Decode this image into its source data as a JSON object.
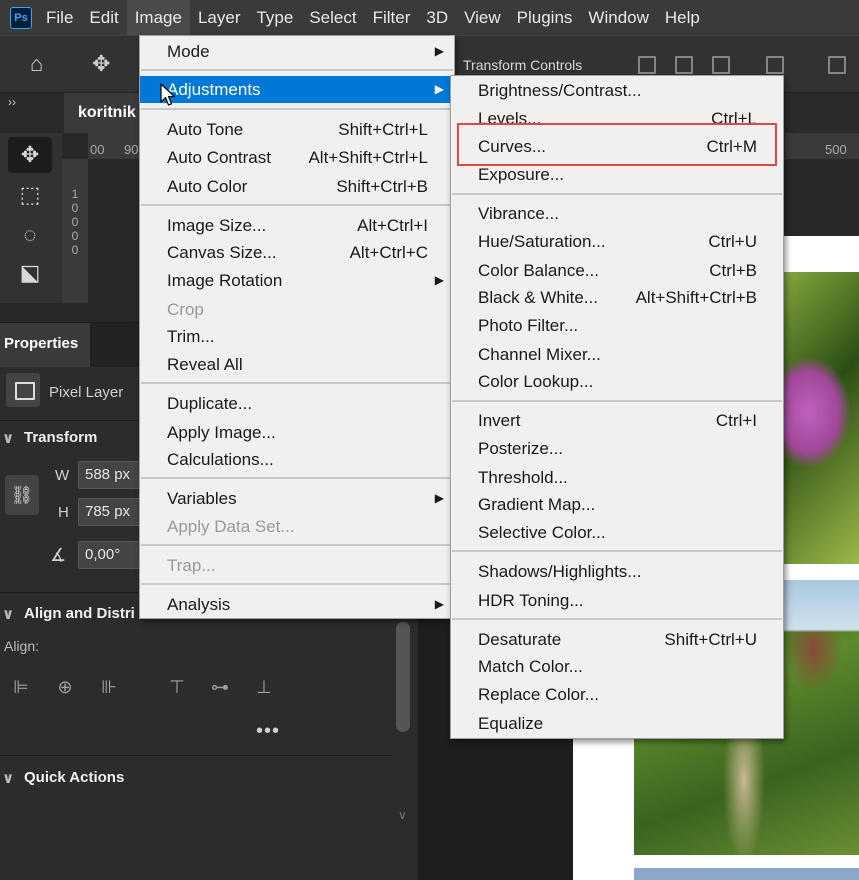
{
  "app": {
    "logo": "Ps"
  },
  "menubar": {
    "items": [
      "File",
      "Edit",
      "Image",
      "Layer",
      "Type",
      "Select",
      "Filter",
      "3D",
      "View",
      "Plugins",
      "Window",
      "Help"
    ],
    "active": "Image"
  },
  "options_bar": {
    "transform_controls": "Transform Controls"
  },
  "document": {
    "tab_title": "koritnik"
  },
  "rulers": {
    "top_left": [
      "00",
      "90"
    ],
    "top_right": "500",
    "left_digits": [
      "1",
      "0",
      "0",
      "0",
      "0"
    ]
  },
  "properties": {
    "tab": "Properties",
    "layer_type": "Pixel Layer",
    "transform": {
      "title": "Transform",
      "w_label": "W",
      "w_value": "588 px",
      "h_label": "H",
      "h_value": "785 px",
      "angle_value": "0,00°"
    },
    "align": {
      "title": "Align and Distri",
      "label": "Align:",
      "more": "•••"
    },
    "quick_actions": {
      "title": "Quick Actions"
    }
  },
  "image_menu": {
    "items": [
      {
        "label": "Mode",
        "submenu": true
      },
      {
        "label": "Adjustments",
        "submenu": true,
        "highlight": true
      },
      {
        "label": "Auto Tone",
        "shortcut": "Shift+Ctrl+L"
      },
      {
        "label": "Auto Contrast",
        "shortcut": "Alt+Shift+Ctrl+L"
      },
      {
        "label": "Auto Color",
        "shortcut": "Shift+Ctrl+B"
      },
      {
        "label": "Image Size...",
        "shortcut": "Alt+Ctrl+I"
      },
      {
        "label": "Canvas Size...",
        "shortcut": "Alt+Ctrl+C"
      },
      {
        "label": "Image Rotation",
        "submenu": true
      },
      {
        "label": "Crop",
        "disabled": true
      },
      {
        "label": "Trim..."
      },
      {
        "label": "Reveal All"
      },
      {
        "label": "Duplicate..."
      },
      {
        "label": "Apply Image..."
      },
      {
        "label": "Calculations..."
      },
      {
        "label": "Variables",
        "submenu": true
      },
      {
        "label": "Apply Data Set...",
        "disabled": true
      },
      {
        "label": "Trap...",
        "disabled": true
      },
      {
        "label": "Analysis",
        "submenu": true
      }
    ]
  },
  "adjustments_menu": {
    "items": [
      {
        "label": "Brightness/Contrast..."
      },
      {
        "label": "Levels...",
        "shortcut": "Ctrl+L"
      },
      {
        "label": "Curves...",
        "shortcut": "Ctrl+M",
        "outlined": true
      },
      {
        "label": "Exposure..."
      },
      {
        "label": "Vibrance..."
      },
      {
        "label": "Hue/Saturation...",
        "shortcut": "Ctrl+U"
      },
      {
        "label": "Color Balance...",
        "shortcut": "Ctrl+B"
      },
      {
        "label": "Black & White...",
        "shortcut": "Alt+Shift+Ctrl+B"
      },
      {
        "label": "Photo Filter..."
      },
      {
        "label": "Channel Mixer..."
      },
      {
        "label": "Color Lookup..."
      },
      {
        "label": "Invert",
        "shortcut": "Ctrl+I"
      },
      {
        "label": "Posterize..."
      },
      {
        "label": "Threshold..."
      },
      {
        "label": "Gradient Map..."
      },
      {
        "label": "Selective Color..."
      },
      {
        "label": "Shadows/Highlights..."
      },
      {
        "label": "HDR Toning..."
      },
      {
        "label": "Desaturate",
        "shortcut": "Shift+Ctrl+U"
      },
      {
        "label": "Match Color..."
      },
      {
        "label": "Replace Color..."
      },
      {
        "label": "Equalize"
      }
    ]
  },
  "colors": {
    "highlight": "#0078d7",
    "outline": "#e04848",
    "ps_blue": "#31a8ff"
  }
}
